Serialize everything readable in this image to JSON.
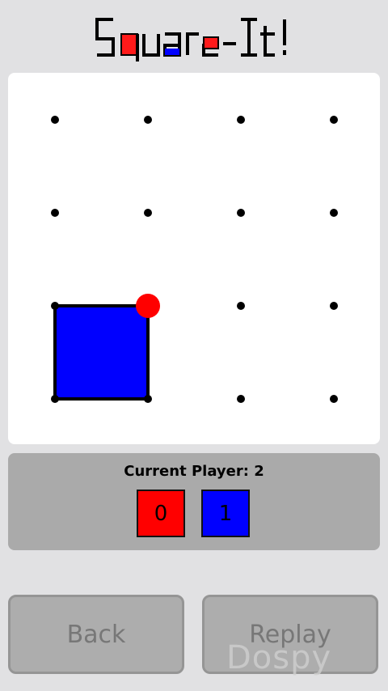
{
  "app": {
    "logo_text": "Square-It!"
  },
  "board": {
    "grid_size": 4,
    "dot_color": "#000000",
    "claimed_square": {
      "row": 2,
      "col": 0,
      "color": "#0000ff",
      "owner": 2
    },
    "cursor": {
      "row": 2,
      "col": 1,
      "color": "#ff0000"
    }
  },
  "status": {
    "current_player": "Current Player: 2",
    "scores": [
      {
        "value": "0",
        "color": "#ff0000"
      },
      {
        "value": "1",
        "color": "#0000ff"
      }
    ]
  },
  "buttons": {
    "back_label": "Back",
    "replay_label": "Replay"
  },
  "watermark": {
    "text": "Dospy"
  }
}
